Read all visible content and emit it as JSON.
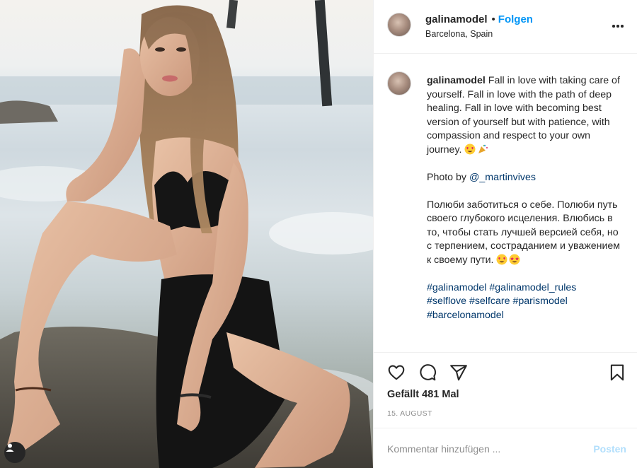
{
  "post": {
    "username": "galinamodel",
    "follow_label": "Folgen",
    "separator": "•",
    "location": "Barcelona, Spain",
    "more_icon": "more-horizontal-icon"
  },
  "caption": {
    "username": "galinamodel",
    "text_en": "Fall in love with taking care of yourself. Fall in love with the path of deep healing. Fall in love with becoming best version of yourself but with patience, with compassion and respect to your own journey.",
    "photo_by": "Photo by",
    "mention": "@_martinvives",
    "text_ru": "Полюби заботиться о себе. Полюби путь своего глубокого исцеления. Влюбись в то, чтобы стать лучшей версией себя, но с терпением, состраданием и уважением к своему пути.",
    "hashtags": [
      "#galinamodel",
      "#galinamodel_rules",
      "#selflove",
      "#selfcare",
      "#parismodel",
      "#barcelonamodel"
    ],
    "emojis_en": [
      "heart-eyes-emoji",
      "party-popper-emoji"
    ],
    "emojis_ru": [
      "heart-eyes-emoji",
      "star-struck-emoji"
    ]
  },
  "actions": {
    "like_icon": "heart-icon",
    "comment_icon": "comment-icon",
    "share_icon": "paper-plane-icon",
    "save_icon": "bookmark-icon"
  },
  "likes_text": "Gefällt 481 Mal",
  "date_text": "15. AUGUST",
  "comment": {
    "placeholder": "Kommentar hinzufügen ...",
    "post_label": "Posten"
  },
  "colors": {
    "accent": "#0095f6",
    "post_disabled": "#b2dffc",
    "link": "#00376b",
    "text": "#262626",
    "muted": "#8e8e8e"
  }
}
